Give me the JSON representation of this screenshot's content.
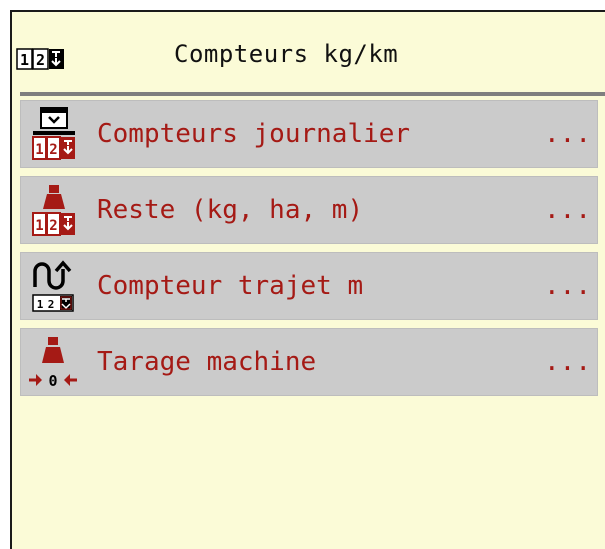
{
  "header": {
    "title": "Compteurs kg/km",
    "icon": "counter-123-icon"
  },
  "menu": {
    "items": [
      {
        "label": "Compteurs journalier",
        "more": "...",
        "icon": "daily-counter-icon"
      },
      {
        "label": "Reste (kg, ha, m)",
        "more": "...",
        "icon": "remaining-weight-counter-icon"
      },
      {
        "label": "Compteur trajet m",
        "more": "...",
        "icon": "trip-counter-icon"
      },
      {
        "label": "Tarage machine",
        "more": "...",
        "icon": "machine-tare-icon"
      }
    ]
  },
  "colors": {
    "background": "#fbfbd7",
    "item_background": "#cbcbcb",
    "label_text": "#a51a15",
    "divider": "#7f7f7f"
  }
}
